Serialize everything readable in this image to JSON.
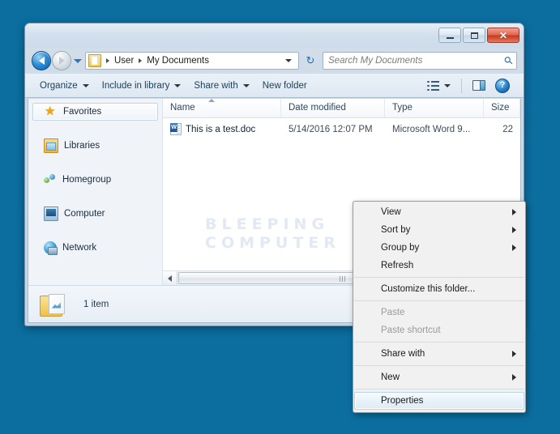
{
  "desktop": {
    "background_color": "#0b6e9f"
  },
  "window": {
    "titlebar": {
      "minimize_label": "Minimize",
      "maximize_label": "Maximize",
      "close_label": "Close",
      "close_glyph": "✕"
    },
    "nav": {
      "back_label": "Back",
      "forward_label": "Forward",
      "recent_pages_label": "Recent pages",
      "refresh_glyph": "↻",
      "address_icon": "documents-folder-icon",
      "breadcrumbs": [
        "User",
        "My Documents"
      ],
      "dropdown_label": "Previous locations"
    },
    "search": {
      "placeholder": "Search My Documents",
      "icon": "search-icon",
      "glyph": "⚲"
    },
    "toolbar": {
      "items": [
        {
          "label": "Organize",
          "has_caret": true
        },
        {
          "label": "Include in library",
          "has_caret": true
        },
        {
          "label": "Share with",
          "has_caret": true
        },
        {
          "label": "New folder",
          "has_caret": false
        }
      ],
      "view_label": "Change your view",
      "preview_label": "Show the preview pane",
      "help_label": "Get help",
      "help_glyph": "?"
    },
    "navpane": {
      "items": [
        {
          "label": "Favorites",
          "icon": "star-icon",
          "selected": true
        },
        {
          "label": "Libraries",
          "icon": "libraries-icon",
          "selected": false
        },
        {
          "label": "Homegroup",
          "icon": "homegroup-icon",
          "selected": false
        },
        {
          "label": "Computer",
          "icon": "computer-icon",
          "selected": false
        },
        {
          "label": "Network",
          "icon": "network-icon",
          "selected": false
        }
      ]
    },
    "filelist": {
      "columns": [
        "Name",
        "Date modified",
        "Type",
        "Size"
      ],
      "sorted_column": "Name",
      "rows": [
        {
          "name": "This is a test.doc",
          "date_modified": "5/14/2016 12:07 PM",
          "type": "Microsoft Word 9...",
          "size": "22",
          "icon": "word-document-icon"
        }
      ],
      "watermark": "BLEEPING\nCOMPUTER"
    },
    "statusbar": {
      "item_count": "1 item",
      "icon": "folder-icon"
    }
  },
  "context_menu": {
    "items": [
      {
        "label": "View",
        "submenu": true,
        "disabled": false,
        "hovered": false,
        "separator_before": false
      },
      {
        "label": "Sort by",
        "submenu": true,
        "disabled": false,
        "hovered": false,
        "separator_before": false
      },
      {
        "label": "Group by",
        "submenu": true,
        "disabled": false,
        "hovered": false,
        "separator_before": false
      },
      {
        "label": "Refresh",
        "submenu": false,
        "disabled": false,
        "hovered": false,
        "separator_before": false
      },
      {
        "label": "Customize this folder...",
        "submenu": false,
        "disabled": false,
        "hovered": false,
        "separator_before": true
      },
      {
        "label": "Paste",
        "submenu": false,
        "disabled": true,
        "hovered": false,
        "separator_before": true
      },
      {
        "label": "Paste shortcut",
        "submenu": false,
        "disabled": true,
        "hovered": false,
        "separator_before": false
      },
      {
        "label": "Share with",
        "submenu": true,
        "disabled": false,
        "hovered": false,
        "separator_before": true
      },
      {
        "label": "New",
        "submenu": true,
        "disabled": false,
        "hovered": false,
        "separator_before": true
      },
      {
        "label": "Properties",
        "submenu": false,
        "disabled": false,
        "hovered": true,
        "separator_before": true
      }
    ]
  }
}
